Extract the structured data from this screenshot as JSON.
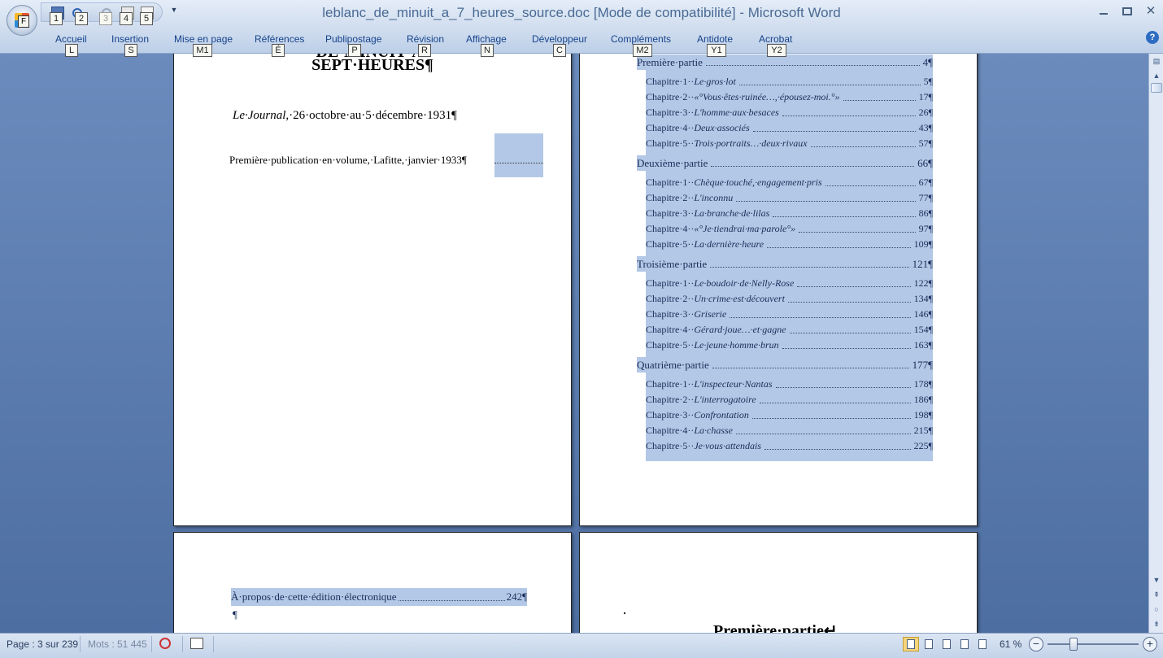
{
  "window": {
    "title": "leblanc_de_minuit_a_7_heures_source.doc [Mode de compatibilité] - Microsoft Word",
    "office_keytip": "F"
  },
  "qat": {
    "keytips": [
      "1",
      "2",
      "3",
      "4",
      "5"
    ]
  },
  "ribbon": {
    "tabs": [
      {
        "label": "Accueil",
        "keytip": "L"
      },
      {
        "label": "Insertion",
        "keytip": "S"
      },
      {
        "label": "Mise en page",
        "keytip": "M1"
      },
      {
        "label": "Références",
        "keytip": "É"
      },
      {
        "label": "Publipostage",
        "keytip": "P"
      },
      {
        "label": "Révision",
        "keytip": "R"
      },
      {
        "label": "Affichage",
        "keytip": "N"
      },
      {
        "label": "Développeur",
        "keytip": "C"
      },
      {
        "label": "Compléments",
        "keytip": "M2"
      },
      {
        "label": "Antidote",
        "keytip": "Y1"
      },
      {
        "label": "Acrobat",
        "keytip": "Y2"
      }
    ],
    "help": "?"
  },
  "page1": {
    "title_top": "DE·MINUIT·À·",
    "title": "SEPT·HEURES¶",
    "journal_italic": "Le·Journal",
    "journal_rest": ",·26·octobre·au·5·décembre·1931¶",
    "publication": "Première·publication·en·volume,·Lafitte,·janvier·1933¶"
  },
  "toc": [
    {
      "kind": "part",
      "label": "Première·partie",
      "page": "4¶"
    },
    {
      "kind": "chap",
      "prefix": "Chapitre·1··",
      "title": "Le·gros·lot",
      "page": "5¶"
    },
    {
      "kind": "chap",
      "prefix": "Chapitre·2··",
      "title": "«°Vous·êtes·ruinée…,·épousez-moi.°»",
      "page": "17¶"
    },
    {
      "kind": "chap",
      "prefix": "Chapitre·3··",
      "title": "L'homme·aux·besaces",
      "page": "26¶"
    },
    {
      "kind": "chap",
      "prefix": "Chapitre·4··",
      "title": "Deux·associés",
      "page": "43¶"
    },
    {
      "kind": "chap",
      "prefix": "Chapitre·5··",
      "title": "Trois·portraits…·deux·rivaux",
      "page": "57¶"
    },
    {
      "kind": "part",
      "label": "Deuxième·partie",
      "page": "66¶"
    },
    {
      "kind": "chap",
      "prefix": "Chapitre·1··",
      "title": "Chèque·touché,·engagement·pris",
      "page": "67¶"
    },
    {
      "kind": "chap",
      "prefix": "Chapitre·2··",
      "title": "L'inconnu",
      "page": "77¶"
    },
    {
      "kind": "chap",
      "prefix": "Chapitre·3··",
      "title": "La·branche·de·lilas",
      "page": "86¶"
    },
    {
      "kind": "chap",
      "prefix": "Chapitre·4··",
      "title": "«°Je·tiendrai·ma·parole°»",
      "page": "97¶"
    },
    {
      "kind": "chap",
      "prefix": "Chapitre·5··",
      "title": "La·dernière·heure",
      "page": "109¶"
    },
    {
      "kind": "part",
      "label": "Troisième·partie",
      "page": "121¶"
    },
    {
      "kind": "chap",
      "prefix": "Chapitre·1··",
      "title": "Le·boudoir·de·Nelly-Rose",
      "page": "122¶"
    },
    {
      "kind": "chap",
      "prefix": "Chapitre·2··",
      "title": "Un·crime·est·découvert",
      "page": "134¶"
    },
    {
      "kind": "chap",
      "prefix": "Chapitre·3··",
      "title": "Griserie",
      "page": "146¶"
    },
    {
      "kind": "chap",
      "prefix": "Chapitre·4··",
      "title": "Gérard·joue…·et·gagne",
      "page": "154¶"
    },
    {
      "kind": "chap",
      "prefix": "Chapitre·5··",
      "title": "Le·jeune·homme·brun",
      "page": "163¶"
    },
    {
      "kind": "part",
      "label": "Quatrième·partie",
      "page": "177¶"
    },
    {
      "kind": "chap",
      "prefix": "Chapitre·1··",
      "title": "L'inspecteur·Nantas",
      "page": "178¶"
    },
    {
      "kind": "chap",
      "prefix": "Chapitre·2··",
      "title": "L'interrogatoire",
      "page": "186¶"
    },
    {
      "kind": "chap",
      "prefix": "Chapitre·3··",
      "title": "Confrontation",
      "page": "198¶"
    },
    {
      "kind": "chap",
      "prefix": "Chapitre·4··",
      "title": "La·chasse",
      "page": "215¶"
    },
    {
      "kind": "chap",
      "prefix": "Chapitre·5··",
      "title": "Je·vous·attendais",
      "page": "225¶"
    }
  ],
  "page3": {
    "toc_label": "À·propos·de·cette·édition·électronique",
    "toc_page": "242¶",
    "pilcrow": "¶"
  },
  "page4": {
    "heading": "Première·partie↵"
  },
  "statusbar": {
    "page": "Page : 3 sur 239",
    "words": "Mots : 51 445",
    "zoom": "61 %",
    "zoom_level_percent": 61
  },
  "colors": {
    "selection": "#b3c8e6",
    "ribbon_text": "#15428b",
    "workspace": "#5b7aa8"
  }
}
